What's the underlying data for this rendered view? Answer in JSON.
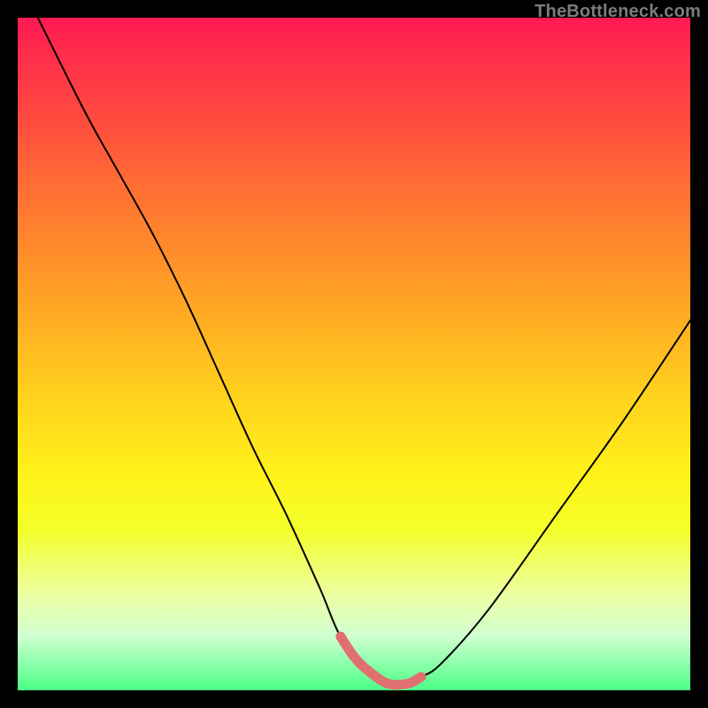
{
  "watermark": "TheBottleneck.com",
  "chart_data": {
    "type": "line",
    "title": "",
    "xlabel": "",
    "ylabel": "",
    "xlim": [
      0,
      100
    ],
    "ylim": [
      0,
      100
    ],
    "series": [
      {
        "name": "curve",
        "color": "#000000",
        "x": [
          3,
          10,
          15,
          20,
          25,
          30,
          35,
          40,
          45,
          48,
          52,
          55,
          58,
          60,
          63,
          70,
          80,
          90,
          100
        ],
        "y": [
          100,
          86,
          77,
          68,
          58,
          47,
          36,
          26,
          15,
          8,
          3,
          1,
          1,
          2,
          4,
          12,
          26,
          40,
          55
        ]
      },
      {
        "name": "highlight",
        "color": "#e07070",
        "x": [
          48,
          50,
          52,
          55,
          58,
          60
        ],
        "y": [
          8,
          5,
          3,
          1,
          1,
          2
        ]
      }
    ]
  }
}
